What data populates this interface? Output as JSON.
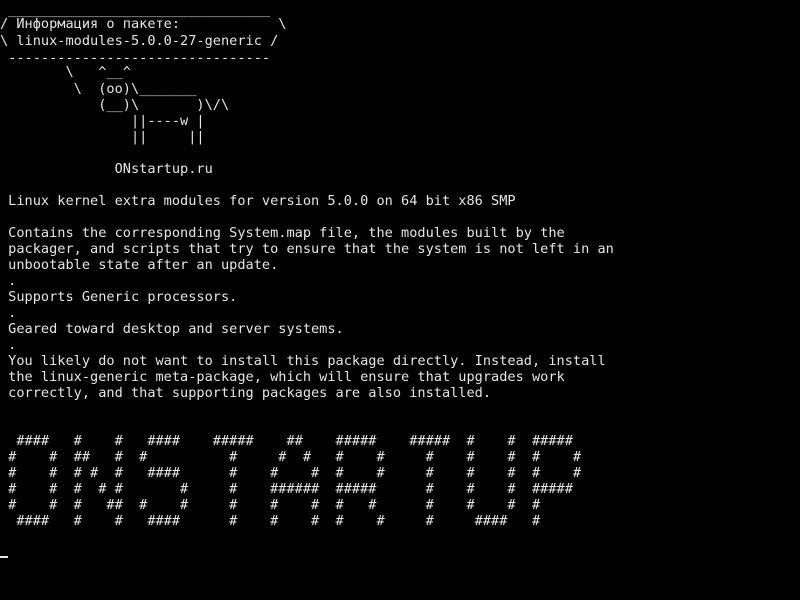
{
  "terminal": {
    "cowsay": {
      "top_border": " ________________________________",
      "bubble_line1": "/ Информация о пакете:            \\",
      "bubble_line2": "\\ linux-modules-5.0.0-27-generic /",
      "bottom_border": " --------------------------------",
      "cow_line1": "        \\   ^__^",
      "cow_line2": "         \\  (oo)\\_______",
      "cow_line3": "            (__)\\       )\\/\\",
      "cow_line4": "                ||----w |",
      "cow_line5": "                ||     ||"
    },
    "site_credit": "              ONstartup.ru",
    "package_info": {
      "summary": " Linux kernel extra modules for version 5.0.0 on 64 bit x86 SMP",
      "desc_line1": " Contains the corresponding System.map file, the modules built by the",
      "desc_line2": " packager, and scripts that try to ensure that the system is not left in an",
      "desc_line3": " unbootable state after an update.",
      "sep1": " .",
      "processors": " Supports Generic processors.",
      "sep2": " .",
      "geared": " Geared toward desktop and server systems.",
      "sep3": " .",
      "note_line1": " You likely do not want to install this package directly. Instead, install",
      "note_line2": " the linux-generic meta-package, which will ensure that upgrades work",
      "note_line3": " correctly, and that supporting packages are also installed."
    },
    "banner": {
      "row1": "  ####   #    #   ####    #####    ##    #####    #####  #    #  #####",
      "row2": " #    #  ##   #  #          #     #  #   #    #     #    #    #  #    #",
      "row3": " #    #  # #  #   ####      #    #    #  #    #     #    #    #  #    #",
      "row4": " #    #  #  # #       #     #    ######  #####      #    #    #  #####",
      "row5": " #    #  #   ##  #    #     #    #    #  #   #      #    #    #  #",
      "row6": "  ####   #    #   ####      #    #    #  #    #     #     ####   #"
    }
  }
}
